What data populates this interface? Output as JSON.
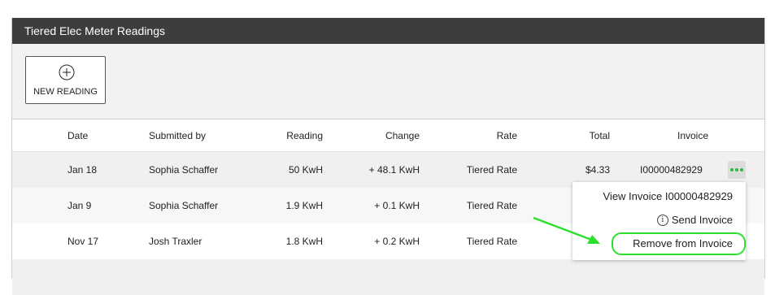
{
  "panel": {
    "title": "Tiered Elec Meter Readings"
  },
  "toolbar": {
    "new_reading_label": "NEW READING"
  },
  "table": {
    "headers": {
      "date": "Date",
      "submitted_by": "Submitted by",
      "reading": "Reading",
      "change": "Change",
      "rate": "Rate",
      "total": "Total",
      "invoice": "Invoice"
    },
    "rows": [
      {
        "date": "Jan 18",
        "submitted_by": "Sophia Schaffer",
        "reading": "50 KwH",
        "change": "+ 48.1 KwH",
        "rate": "Tiered Rate",
        "total": "$4.33",
        "invoice": "I00000482929"
      },
      {
        "date": "Jan 9",
        "submitted_by": "Sophia Schaffer",
        "reading": "1.9 KwH",
        "change": "+ 0.1 KwH",
        "rate": "Tiered Rate",
        "total": "",
        "invoice": ""
      },
      {
        "date": "Nov 17",
        "submitted_by": "Josh Traxler",
        "reading": "1.8 KwH",
        "change": "+ 0.2 KwH",
        "rate": "Tiered Rate",
        "total": "",
        "invoice": ""
      }
    ]
  },
  "context_menu": {
    "view_invoice": "View Invoice I00000482929",
    "send_invoice": "Send Invoice",
    "remove_from_invoice": "Remove from Invoice"
  },
  "colors": {
    "header_bg": "#3d3d3d",
    "accent_green": "#2db83d",
    "highlight_green": "#2ee02e"
  },
  "icons": {
    "new_reading": "plus-circle-icon",
    "row_actions": "more-horizontal-icon",
    "send_invoice": "info-icon"
  }
}
